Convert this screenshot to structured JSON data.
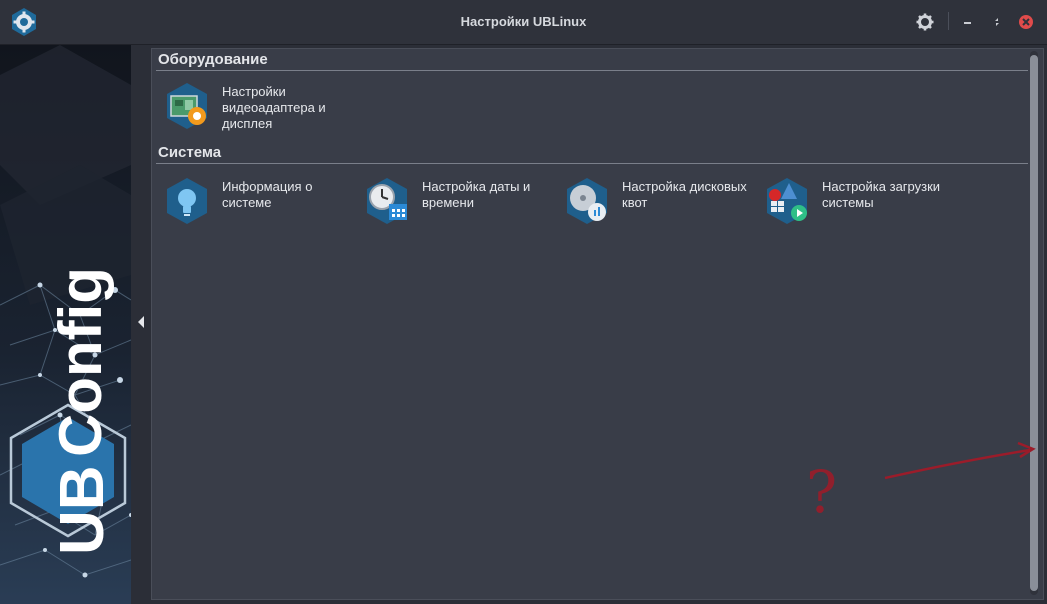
{
  "window": {
    "title": "Настройки UBLinux",
    "app_icon": "ubconfig-gear-icon",
    "buttons": {
      "settings": "gear-icon",
      "minimize": "minimize-icon",
      "maximize": "maximize-icon",
      "close": "close-icon"
    }
  },
  "sidebar": {
    "brand_text": "UBConfig",
    "brand_prefix": "UB",
    "brand_suffix": "Config",
    "collapse_icon": "collapse-left-icon"
  },
  "sections": [
    {
      "title": "Оборудование",
      "items": [
        {
          "label": "Настройки видеоадаптера и дисплея",
          "icon": "video-adapter-icon"
        }
      ]
    },
    {
      "title": "Система",
      "items": [
        {
          "label": "Информация о системе",
          "icon": "info-bulb-icon"
        },
        {
          "label": "Настройка даты и времени",
          "icon": "clock-calendar-icon"
        },
        {
          "label": "Настройка дисковых квот",
          "icon": "disk-quota-icon"
        },
        {
          "label": "Настройка загрузки системы",
          "icon": "boot-loader-icon"
        }
      ]
    }
  ],
  "annotation": {
    "text": "?",
    "color": "#9b1c2a"
  },
  "colors": {
    "accent": "#2a7fb5",
    "panel": "#393d48",
    "close": "#e04b4b"
  }
}
